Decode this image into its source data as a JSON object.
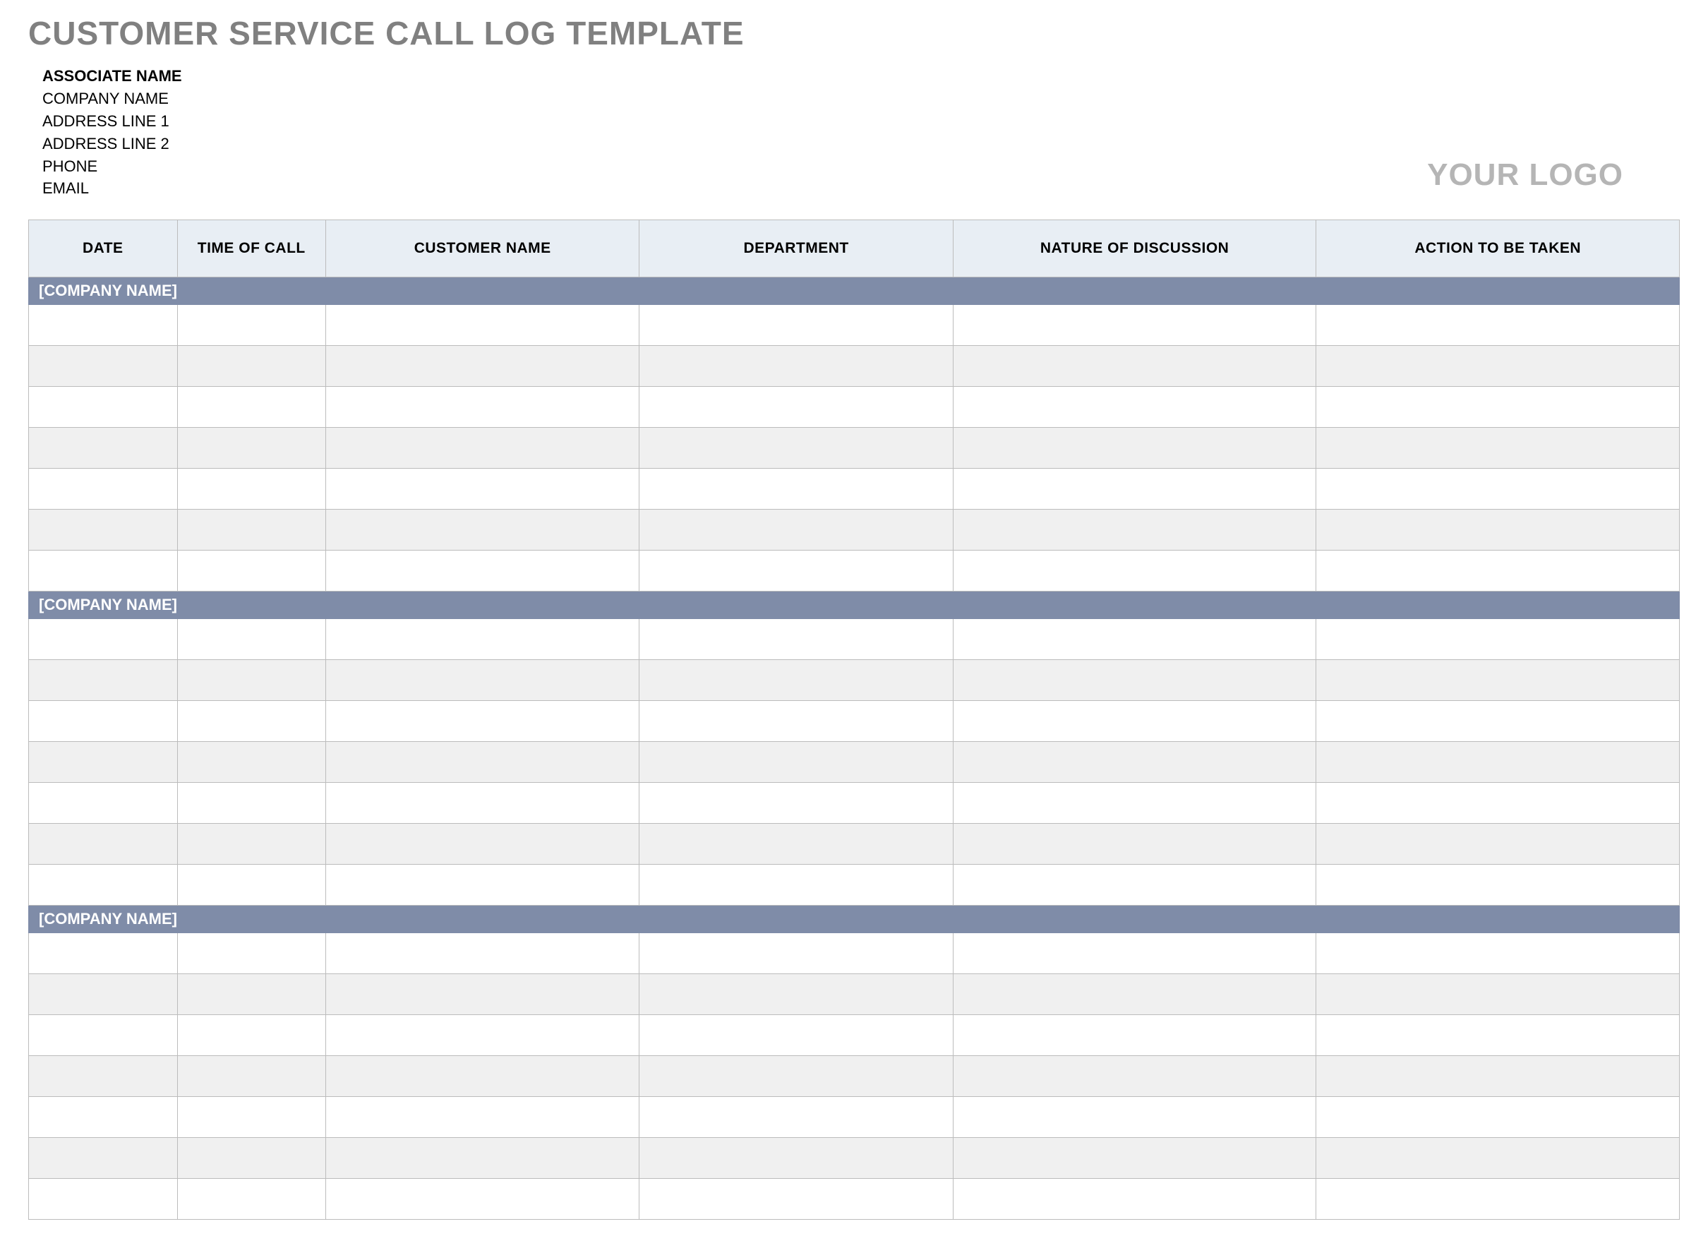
{
  "title": "CUSTOMER SERVICE CALL LOG TEMPLATE",
  "info": {
    "associate_name": "ASSOCIATE NAME",
    "company_name": "COMPANY NAME",
    "address_line_1": "ADDRESS LINE 1",
    "address_line_2": "ADDRESS LINE 2",
    "phone": "PHONE",
    "email": "EMAIL"
  },
  "logo_text": "YOUR LOGO",
  "columns": {
    "date": "DATE",
    "time_of_call": "TIME OF CALL",
    "customer_name": "CUSTOMER NAME",
    "department": "DEPARTMENT",
    "nature_of_discussion": "NATURE OF DISCUSSION",
    "action_to_be_taken": "ACTION TO BE TAKEN"
  },
  "sections": [
    {
      "label": "[COMPANY NAME]",
      "rows": [
        {
          "date": "",
          "time_of_call": "",
          "customer_name": "",
          "department": "",
          "nature_of_discussion": "",
          "action_to_be_taken": ""
        },
        {
          "date": "",
          "time_of_call": "",
          "customer_name": "",
          "department": "",
          "nature_of_discussion": "",
          "action_to_be_taken": ""
        },
        {
          "date": "",
          "time_of_call": "",
          "customer_name": "",
          "department": "",
          "nature_of_discussion": "",
          "action_to_be_taken": ""
        },
        {
          "date": "",
          "time_of_call": "",
          "customer_name": "",
          "department": "",
          "nature_of_discussion": "",
          "action_to_be_taken": ""
        },
        {
          "date": "",
          "time_of_call": "",
          "customer_name": "",
          "department": "",
          "nature_of_discussion": "",
          "action_to_be_taken": ""
        },
        {
          "date": "",
          "time_of_call": "",
          "customer_name": "",
          "department": "",
          "nature_of_discussion": "",
          "action_to_be_taken": ""
        },
        {
          "date": "",
          "time_of_call": "",
          "customer_name": "",
          "department": "",
          "nature_of_discussion": "",
          "action_to_be_taken": ""
        }
      ]
    },
    {
      "label": "[COMPANY NAME]",
      "rows": [
        {
          "date": "",
          "time_of_call": "",
          "customer_name": "",
          "department": "",
          "nature_of_discussion": "",
          "action_to_be_taken": ""
        },
        {
          "date": "",
          "time_of_call": "",
          "customer_name": "",
          "department": "",
          "nature_of_discussion": "",
          "action_to_be_taken": ""
        },
        {
          "date": "",
          "time_of_call": "",
          "customer_name": "",
          "department": "",
          "nature_of_discussion": "",
          "action_to_be_taken": ""
        },
        {
          "date": "",
          "time_of_call": "",
          "customer_name": "",
          "department": "",
          "nature_of_discussion": "",
          "action_to_be_taken": ""
        },
        {
          "date": "",
          "time_of_call": "",
          "customer_name": "",
          "department": "",
          "nature_of_discussion": "",
          "action_to_be_taken": ""
        },
        {
          "date": "",
          "time_of_call": "",
          "customer_name": "",
          "department": "",
          "nature_of_discussion": "",
          "action_to_be_taken": ""
        },
        {
          "date": "",
          "time_of_call": "",
          "customer_name": "",
          "department": "",
          "nature_of_discussion": "",
          "action_to_be_taken": ""
        }
      ]
    },
    {
      "label": "[COMPANY NAME]",
      "rows": [
        {
          "date": "",
          "time_of_call": "",
          "customer_name": "",
          "department": "",
          "nature_of_discussion": "",
          "action_to_be_taken": ""
        },
        {
          "date": "",
          "time_of_call": "",
          "customer_name": "",
          "department": "",
          "nature_of_discussion": "",
          "action_to_be_taken": ""
        },
        {
          "date": "",
          "time_of_call": "",
          "customer_name": "",
          "department": "",
          "nature_of_discussion": "",
          "action_to_be_taken": ""
        },
        {
          "date": "",
          "time_of_call": "",
          "customer_name": "",
          "department": "",
          "nature_of_discussion": "",
          "action_to_be_taken": ""
        },
        {
          "date": "",
          "time_of_call": "",
          "customer_name": "",
          "department": "",
          "nature_of_discussion": "",
          "action_to_be_taken": ""
        },
        {
          "date": "",
          "time_of_call": "",
          "customer_name": "",
          "department": "",
          "nature_of_discussion": "",
          "action_to_be_taken": ""
        },
        {
          "date": "",
          "time_of_call": "",
          "customer_name": "",
          "department": "",
          "nature_of_discussion": "",
          "action_to_be_taken": ""
        }
      ]
    }
  ]
}
